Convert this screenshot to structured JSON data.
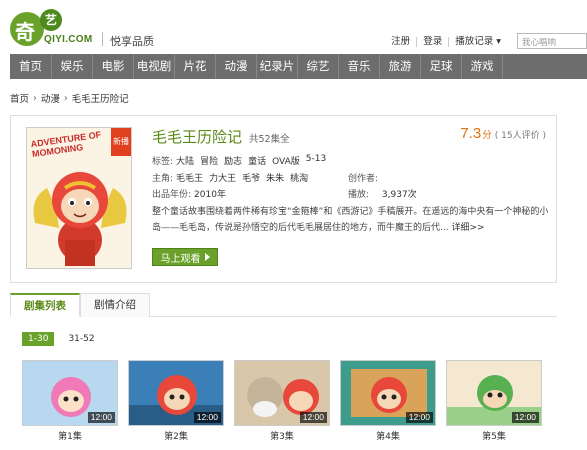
{
  "header": {
    "logo_char": "奇",
    "logo_yi": "艺",
    "logo_domain": "QIYI.COM",
    "slogan": "悦享品质",
    "links": [
      "注册",
      "登录",
      "播放记录 ▾"
    ],
    "search_placeholder": "我心唱响"
  },
  "nav": [
    "首页",
    "娱乐",
    "电影",
    "电视剧",
    "片花",
    "动漫",
    "纪录片",
    "综艺",
    "音乐",
    "旅游",
    "足球",
    "游戏"
  ],
  "breadcrumb": [
    "首页",
    "动漫",
    "毛毛王历险记"
  ],
  "detail": {
    "poster_title": "ADVENTURE OF MOMONING",
    "poster_badge": "新播",
    "title": "毛毛王历险记",
    "episode_total": "共52集全",
    "rating_score": "7.3",
    "rating_unit": "分",
    "rating_count": "( 15人评价 )",
    "tags_label": "标签:",
    "tags": [
      "大陆",
      "冒险",
      "励志",
      "童话",
      "OVA版",
      "5-13"
    ],
    "cast_label": "主角:",
    "cast": [
      "毛毛王",
      "力大王",
      "毛爷",
      "朱朱",
      "桃淘"
    ],
    "year_label": "出品年份:",
    "year": "2010年",
    "creator_label": "创作者:",
    "creator": "",
    "plays_label": "播放:",
    "plays": "3,937次",
    "description": "整个童话故事围绕着两件稀有珍宝“金箍棒”和《西游记》手稿展开。在遥远的海中央有一个神秘的小岛——毛毛岛，传说是孙悟空的后代毛毛展居住的地方，而牛魔王的后代...",
    "more_label": "详细>>",
    "watch_label": "马上观看"
  },
  "tabs": [
    "剧集列表",
    "剧情介绍"
  ],
  "ranges": [
    "1-30",
    "31-52"
  ],
  "episodes": [
    {
      "label": "第1集",
      "duration": "12:00"
    },
    {
      "label": "第2集",
      "duration": "12:00"
    },
    {
      "label": "第3集",
      "duration": "12:00"
    },
    {
      "label": "第4集",
      "duration": "12:00"
    },
    {
      "label": "第5集",
      "duration": "12:00"
    }
  ],
  "colors": {
    "brand_green": "#6aa12a",
    "nav_gray": "#6d6d6d",
    "rating_orange": "#e0720e"
  }
}
